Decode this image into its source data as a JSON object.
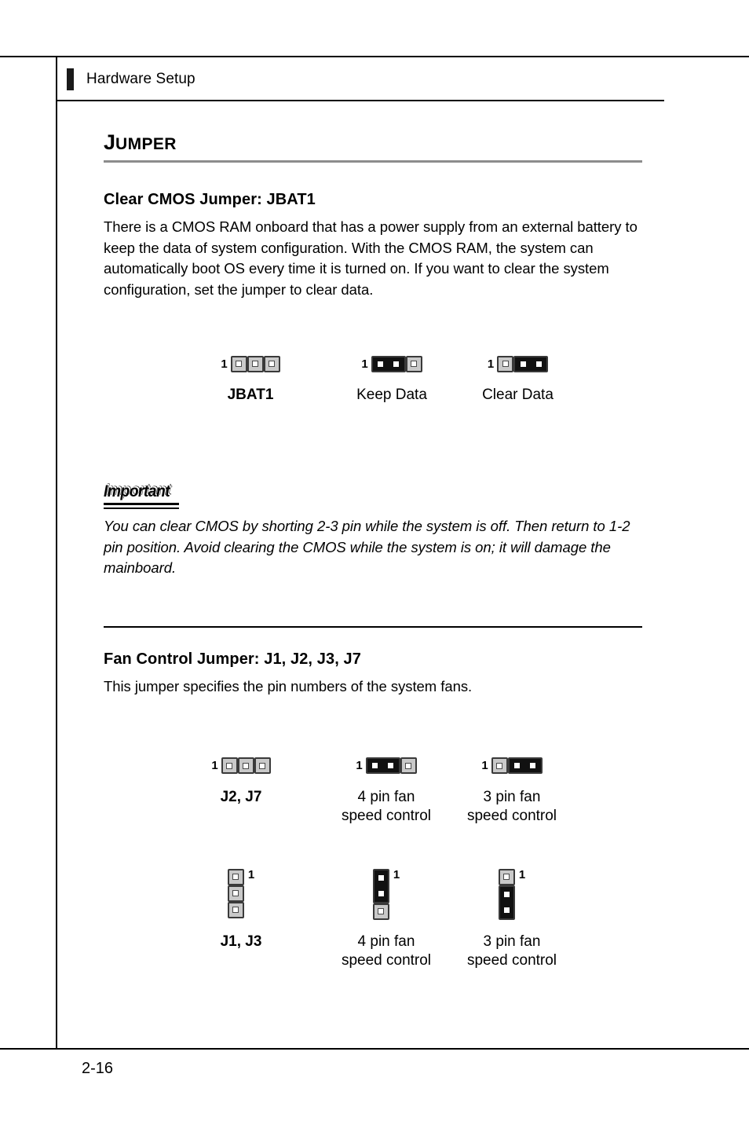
{
  "header": {
    "title": "Hardware Setup"
  },
  "section": {
    "title_first_letter": "J",
    "title_rest": "UMPER"
  },
  "clear_cmos": {
    "heading": "Clear CMOS Jumper: JBAT1",
    "paragraph": "There is a CMOS RAM onboard that has a power supply from an external battery to keep the data of system configuration. With the CMOS RAM, the system can automatically boot OS every time it is turned on. If you want to clear the system configuration, set the jumper to clear data.",
    "diagrams": [
      {
        "pin_one_label": "1",
        "caption": "JBAT1",
        "caption_bold": true
      },
      {
        "pin_one_label": "1",
        "caption": "Keep Data",
        "caption_bold": false
      },
      {
        "pin_one_label": "1",
        "caption": "Clear Data",
        "caption_bold": false
      }
    ]
  },
  "important": {
    "heading": "Important",
    "paragraph": "You can clear CMOS by shorting 2-3 pin while the system is off. Then return to 1-2 pin position. Avoid clearing the CMOS while the system is on; it will damage the mainboard."
  },
  "fan_control": {
    "heading": "Fan Control Jumper: J1, J2, J3, J7",
    "paragraph": "This jumper specifies the pin numbers of the system fans.",
    "horizontal_diagrams": [
      {
        "pin_one_label": "1",
        "caption": "J2, J7",
        "caption_bold": true
      },
      {
        "pin_one_label": "1",
        "caption": "4 pin fan\nspeed control",
        "caption_bold": false
      },
      {
        "pin_one_label": "1",
        "caption": "3 pin fan\nspeed control",
        "caption_bold": false
      }
    ],
    "vertical_diagrams": [
      {
        "pin_one_label": "1",
        "caption": "J1, J3",
        "caption_bold": true
      },
      {
        "pin_one_label": "1",
        "caption": "4 pin fan\nspeed control",
        "caption_bold": false
      },
      {
        "pin_one_label": "1",
        "caption": "3 pin fan\nspeed control",
        "caption_bold": false
      }
    ]
  },
  "footer": {
    "page_number": "2-16"
  }
}
